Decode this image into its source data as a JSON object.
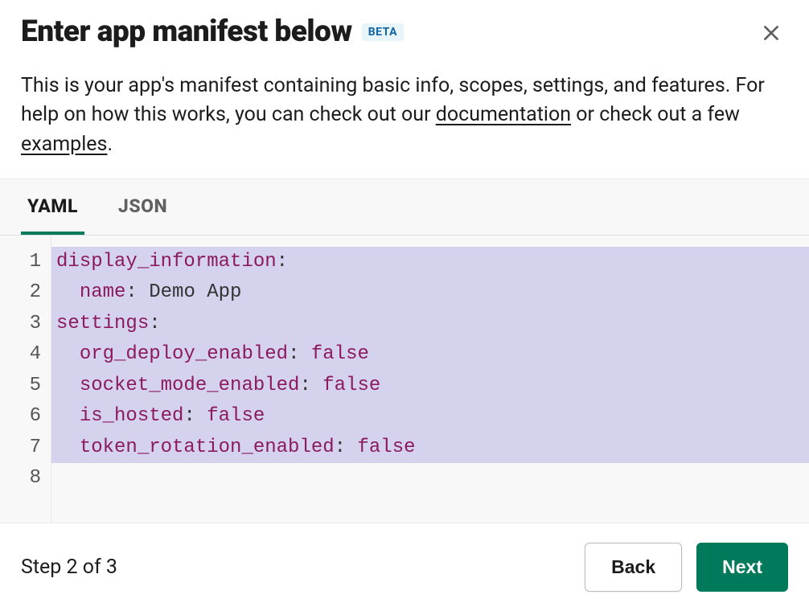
{
  "header": {
    "title": "Enter app manifest below",
    "badge": "BETA"
  },
  "description": {
    "text_before_doc": "This is your app's manifest containing basic info, scopes, settings, and features. For help on how this works, you can check out our ",
    "documentation_link": "documentation",
    "text_mid": " or check out a few ",
    "examples_link": "examples",
    "text_end": "."
  },
  "tabs": {
    "yaml": "YAML",
    "json": "JSON"
  },
  "code": {
    "lines": [
      {
        "num": "1",
        "indent": "",
        "key": "display_information",
        "colon": ":",
        "value": "",
        "highlight": true
      },
      {
        "num": "2",
        "indent": "  ",
        "key": "name",
        "colon": ":",
        "value": " Demo App",
        "highlight": true
      },
      {
        "num": "3",
        "indent": "",
        "key": "settings",
        "colon": ":",
        "value": "",
        "highlight": true
      },
      {
        "num": "4",
        "indent": "  ",
        "key": "org_deploy_enabled",
        "colon": ":",
        "bool": " false",
        "highlight": true
      },
      {
        "num": "5",
        "indent": "  ",
        "key": "socket_mode_enabled",
        "colon": ":",
        "bool": " false",
        "highlight": true
      },
      {
        "num": "6",
        "indent": "  ",
        "key": "is_hosted",
        "colon": ":",
        "bool": " false",
        "highlight": true
      },
      {
        "num": "7",
        "indent": "  ",
        "key": "token_rotation_enabled",
        "colon": ":",
        "bool": " false",
        "highlight": true
      },
      {
        "num": "8",
        "indent": "",
        "key": "",
        "colon": "",
        "value": "",
        "highlight": false
      }
    ]
  },
  "footer": {
    "step_indicator": "Step 2 of 3",
    "back_label": "Back",
    "next_label": "Next"
  }
}
